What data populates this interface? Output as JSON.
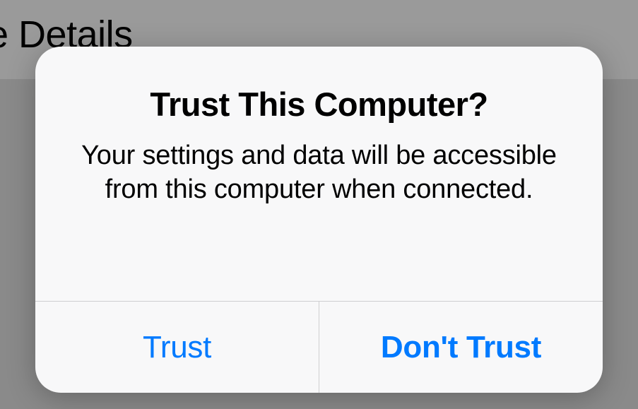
{
  "background": {
    "partial_text": "e Details"
  },
  "alert": {
    "title": "Trust This Computer?",
    "message": "Your settings and data will be accessible from this computer when connected.",
    "trust_label": "Trust",
    "dont_trust_label": "Don't Trust"
  },
  "colors": {
    "accent": "#007aff",
    "alert_bg": "#f8f8f9",
    "divider": "#cfcfd1",
    "backdrop_top": "#9a9a9a",
    "backdrop_bottom": "#8a8a8a"
  }
}
